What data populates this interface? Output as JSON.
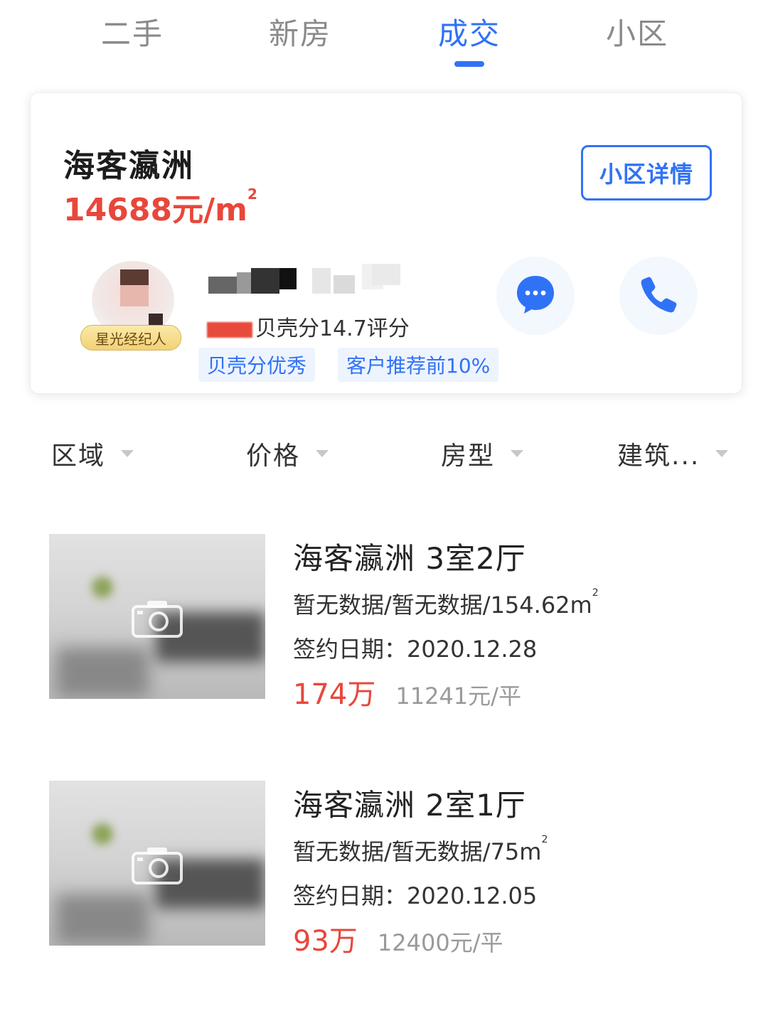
{
  "tabs": [
    {
      "label": "二手"
    },
    {
      "label": "新房"
    },
    {
      "label": "成交",
      "active": true
    },
    {
      "label": "小区"
    }
  ],
  "community": {
    "name": "海客瀛洲",
    "price": "14688元/m",
    "price_sup": "2",
    "detail_button": "小区详情",
    "agent": {
      "badge": "星光经纪人",
      "score_text": "贝壳分14.7评分",
      "tags": [
        "贝壳分优秀",
        "客户推荐前10%"
      ]
    }
  },
  "filters": [
    {
      "label": "区域"
    },
    {
      "label": "价格"
    },
    {
      "label": "房型"
    },
    {
      "label": "建筑..."
    }
  ],
  "listings": [
    {
      "title": "海客瀛洲 3室2厅",
      "meta": "暂无数据/暂无数据/154.62m",
      "meta_sup": "2",
      "sign_date": "签约日期：2020.12.28",
      "price": "174万",
      "unit_price": "11241元/平"
    },
    {
      "title": "海客瀛洲 2室1厅",
      "meta": "暂无数据/暂无数据/75m",
      "meta_sup": "2",
      "sign_date": "签约日期：2020.12.05",
      "price": "93万",
      "unit_price": "12400元/平"
    }
  ],
  "colors": {
    "accent": "#3072f6",
    "price_red": "#e8473b",
    "tag_bg": "#eef4fe"
  }
}
